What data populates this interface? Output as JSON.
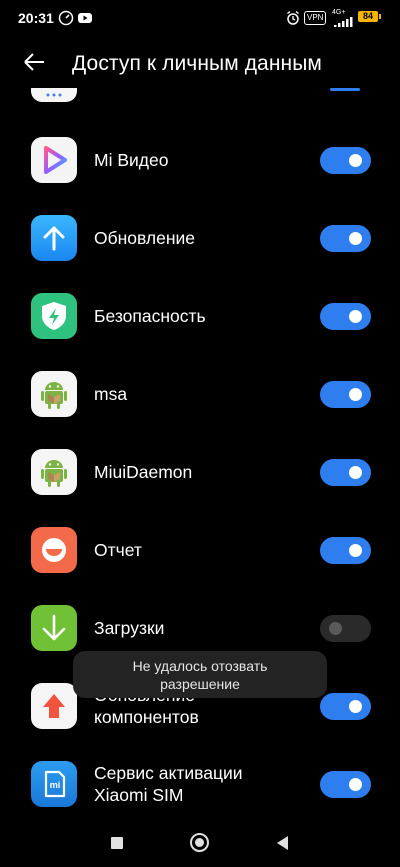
{
  "status_bar": {
    "time": "20:31",
    "vpn": "VPN",
    "network": "4G+",
    "battery": "84"
  },
  "header": {
    "title": "Доступ к личным данным"
  },
  "apps": [
    {
      "label": "Mi Видео",
      "enabled": true,
      "icon": "mi-video-icon"
    },
    {
      "label": "Обновление",
      "enabled": true,
      "icon": "update-icon"
    },
    {
      "label": "Безопасность",
      "enabled": true,
      "icon": "security-icon"
    },
    {
      "label": "msa",
      "enabled": true,
      "icon": "android-icon"
    },
    {
      "label": "MiuiDaemon",
      "enabled": true,
      "icon": "android-icon"
    },
    {
      "label": "Отчет",
      "enabled": true,
      "icon": "report-icon"
    },
    {
      "label": "Загрузки",
      "enabled": false,
      "icon": "downloads-icon"
    },
    {
      "label_line1": "Обновление",
      "label_line2": "компонентов",
      "enabled": true,
      "icon": "component-update-icon"
    },
    {
      "label_line1": "Сервис активации",
      "label_line2": "Xiaomi SIM",
      "enabled": true,
      "icon": "xiaomi-sim-icon"
    }
  ],
  "toast": {
    "line1": "Не удалось отозвать",
    "line2": "разрешение"
  },
  "colors": {
    "toggle_on": "#2f7ef0",
    "toggle_off": "#2a2a2a",
    "background": "#000000"
  }
}
